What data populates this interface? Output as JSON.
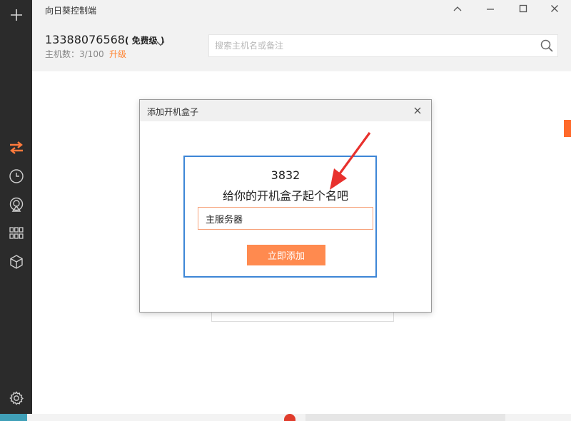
{
  "app": {
    "title": "向日葵控制端"
  },
  "sidebar": {
    "items": [
      {
        "icon": "plus-icon"
      },
      {
        "icon": "swap-arrows-icon"
      },
      {
        "icon": "clock-icon"
      },
      {
        "icon": "remote-desktop-icon"
      },
      {
        "icon": "grid-icon"
      },
      {
        "icon": "cube-icon"
      },
      {
        "icon": "gear-icon"
      }
    ]
  },
  "account": {
    "number": "13388076568",
    "plan": "( 免费级 )",
    "host_count": "主机数：3/100",
    "upgrade": "升级"
  },
  "search": {
    "placeholder": "搜索主机名或备注"
  },
  "dialog": {
    "title": "添加开机盒子",
    "box_id": "3832",
    "prompt": "给你的开机盒子起个名吧",
    "name_value": "主服务器",
    "submit_label": "立即添加"
  },
  "colors": {
    "accent": "#ff8533",
    "button": "#ff8a4f",
    "highlight_border": "#3d86d6",
    "annotation_arrow": "#e8312d",
    "sidebar": "#2b2b2b"
  }
}
